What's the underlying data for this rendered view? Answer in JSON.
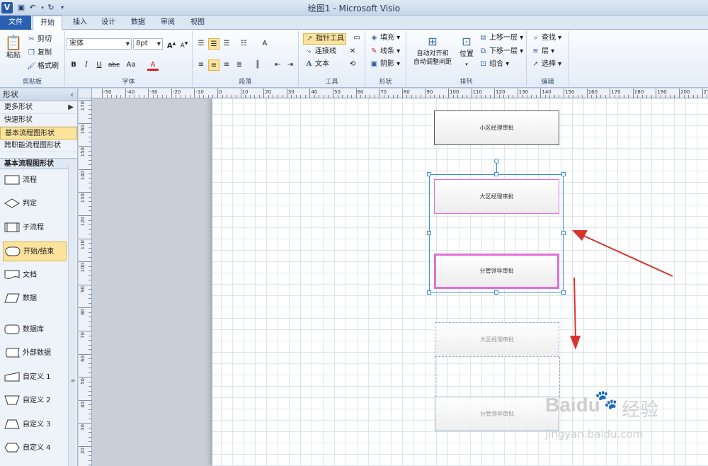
{
  "window": {
    "title": "绘图1  -  Microsoft Visio",
    "app_icon": "V",
    "quick_access": [
      "save-icon",
      "undo-icon",
      "redo-icon",
      "customize-icon"
    ]
  },
  "tabs": [
    "文件",
    "开始",
    "插入",
    "设计",
    "数据",
    "审阅",
    "视图"
  ],
  "active_tab": "开始",
  "ribbon": {
    "clipboard": {
      "label": "剪贴板",
      "paste": "粘贴",
      "cut": "剪切",
      "copy": "复制",
      "format_painter": "格式刷"
    },
    "font": {
      "label": "字体",
      "font_name": "宋体",
      "font_size": "8pt",
      "bold": "B",
      "italic": "I",
      "underline": "U",
      "strike": "abc",
      "case": "Aa",
      "color": "A"
    },
    "paragraph": {
      "label": "段落"
    },
    "tools": {
      "label": "工具",
      "pointer": "指针工具",
      "connector": "连接线",
      "text": "文本"
    },
    "shape": {
      "label": "形状",
      "fill": "填充",
      "line": "线条",
      "shadow": "阴影"
    },
    "arrange": {
      "label": "排列",
      "auto_align_line1": "自动对齐和",
      "auto_align_line2": "自动调整间距",
      "position": "位置",
      "bring_forward": "上移一层",
      "send_backward": "下移一层",
      "group": "组合"
    },
    "editing": {
      "label": "编辑",
      "find": "查找",
      "layer": "层",
      "select": "选择"
    }
  },
  "shapes_pane": {
    "title": "形状",
    "collapse": "‹",
    "more_shapes": "更多形状",
    "quick_shapes": "快速形状",
    "basic_flowchart": "基本流程图形状",
    "cross_functional": "跨职能流程图形状",
    "stencil_title": "基本流程图形状",
    "items": [
      "流程",
      "判定",
      "子流程",
      "开始/结束",
      "文档",
      "数据",
      "数据库",
      "外部数据",
      "自定义 1",
      "自定义 2",
      "自定义 3",
      "自定义 4"
    ],
    "selected_item": "开始/结束"
  },
  "ruler": {
    "h_ticks": [
      "-50",
      "-40",
      "-30",
      "-20",
      "-10",
      "0",
      "10",
      "20",
      "30",
      "40",
      "50",
      "60",
      "70",
      "80",
      "90",
      "100",
      "110",
      "120",
      "130",
      "140",
      "150",
      "160",
      "170",
      "180",
      "190",
      "200",
      "210"
    ],
    "v_ticks": [
      "170",
      "160",
      "150",
      "140",
      "130",
      "120",
      "110",
      "100",
      "90",
      "80",
      "70",
      "60",
      "50",
      "40",
      "30",
      "20"
    ]
  },
  "diagram": {
    "boxes": [
      "小区经理审批",
      "大区经理审批",
      "分管领导审批",
      "大区经理审批",
      "分管领导审批"
    ]
  },
  "watermark": {
    "brand": "Baidu",
    "cn": "经验",
    "url": "jingyan.baidu.com"
  },
  "colors": {
    "accent_file": "#2b5fb4",
    "highlight": "#fbe39b",
    "selection": "#3b8fd8",
    "magenta_border": "#e070d8",
    "arrow": "#d9342b"
  }
}
